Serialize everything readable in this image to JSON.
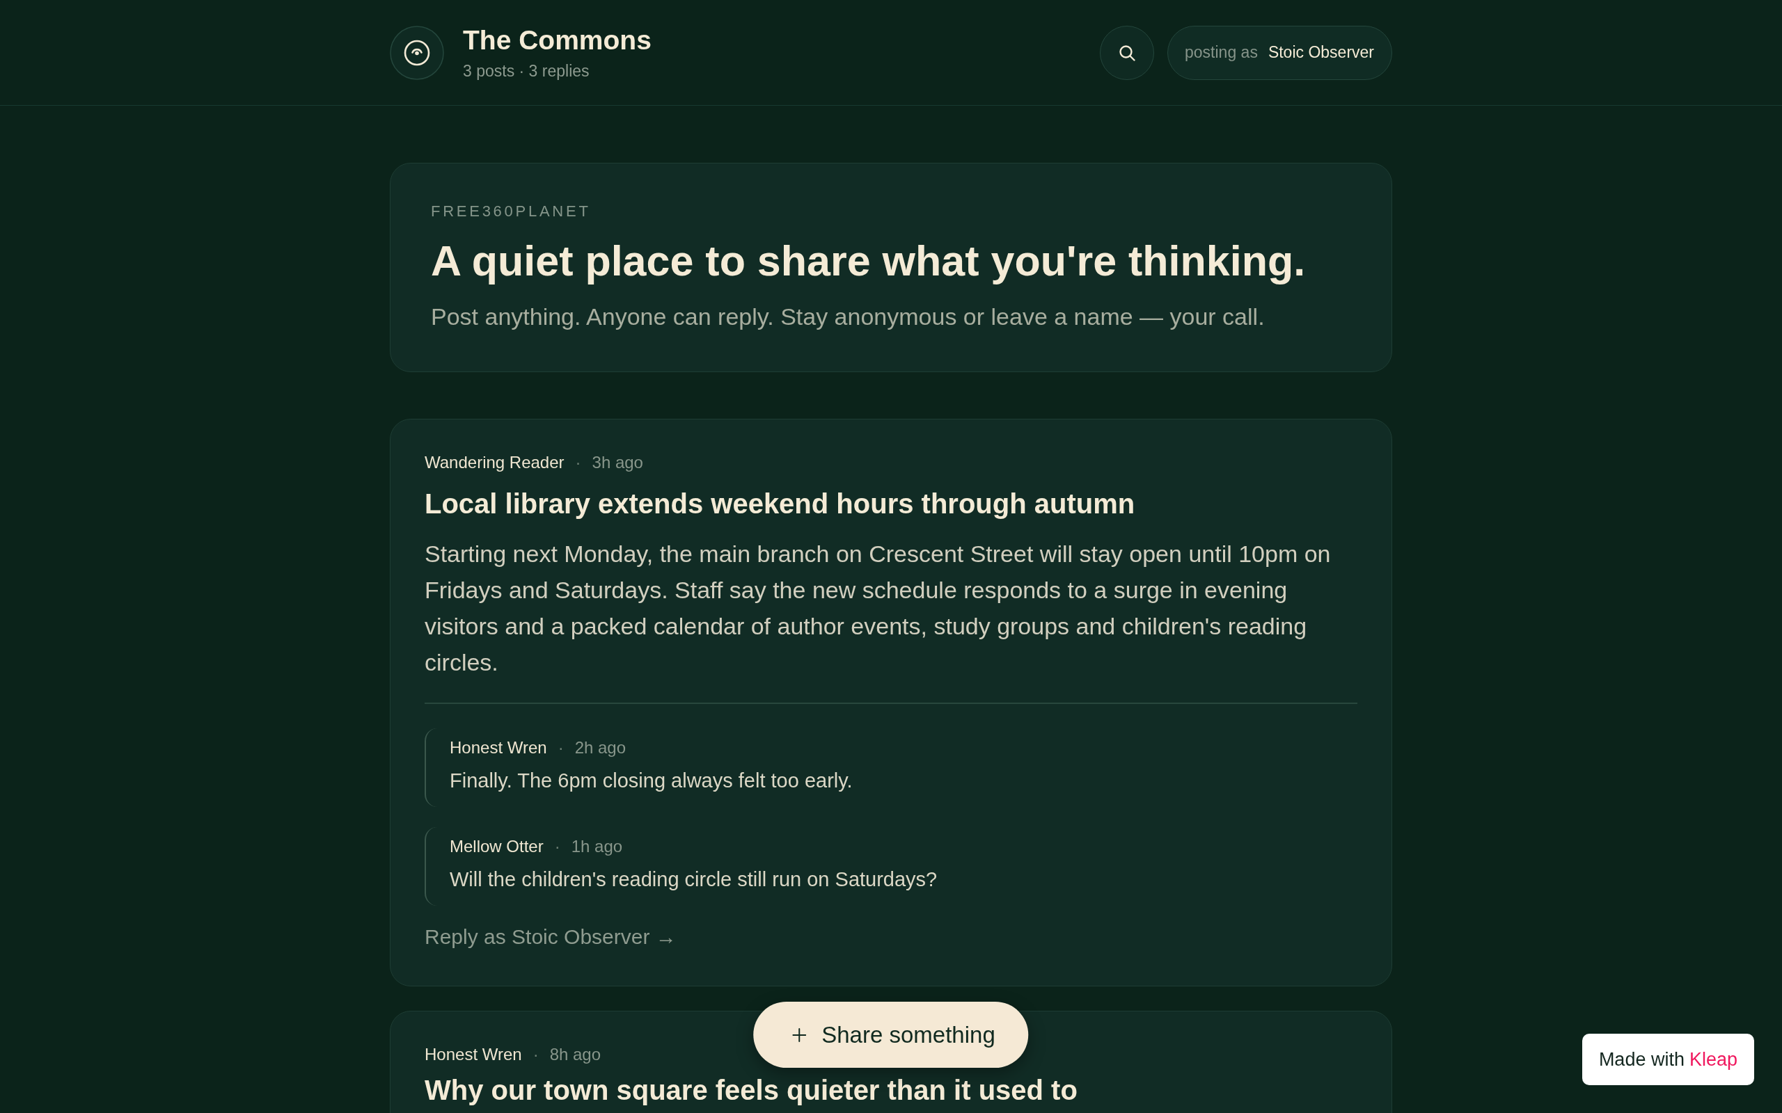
{
  "header": {
    "title": "The Commons",
    "subtitle": "3 posts · 3 replies",
    "posting_label": "posting as",
    "posting_name": "Stoic Observer"
  },
  "hero": {
    "eyebrow": "FREE360PLANET",
    "headline": "A quiet place to share what you're thinking.",
    "tagline": "Post anything. Anyone can reply. Stay anonymous or leave a name — your call."
  },
  "posts": [
    {
      "author": "Wandering Reader",
      "separator": "·",
      "time": "3h ago",
      "title": "Local library extends weekend hours through autumn",
      "body": "Starting next Monday, the main branch on Crescent Street will stay open until 10pm on Fridays and Saturdays. Staff say the new schedule responds to a surge in evening visitors and a packed calendar of author events, study groups and children's reading circles.",
      "replies": [
        {
          "author": "Honest Wren",
          "separator": "·",
          "time": "2h ago",
          "text": "Finally. The 6pm closing always felt too early."
        },
        {
          "author": "Mellow Otter",
          "separator": "·",
          "time": "1h ago",
          "text": "Will the children's reading circle still run on Saturdays?"
        }
      ],
      "reply_link": "Reply as Stoic Observer →"
    },
    {
      "author": "Honest Wren",
      "separator": "·",
      "time": "8h ago",
      "title": "Why our town square feels quieter than it used to"
    }
  ],
  "share_button": {
    "label": "Share something"
  },
  "badge": {
    "prefix": "Made with",
    "brand": "Kleap"
  }
}
